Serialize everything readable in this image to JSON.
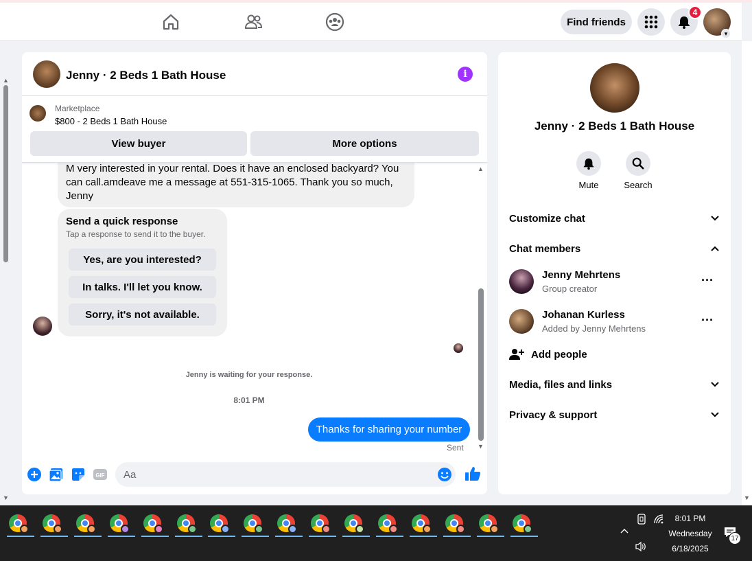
{
  "topbar": {
    "find_friends_label": "Find friends",
    "notification_count": "4",
    "icons": [
      "home-icon",
      "friends-icon",
      "groups-icon",
      "menu-grid-icon",
      "bell-icon"
    ]
  },
  "chat": {
    "header_title": "Jenny · 2 Beds 1 Bath House",
    "marketplace_label": "Marketplace",
    "marketplace_listing": "$800 - 2 Beds 1 Bath House",
    "view_buyer_label": "View buyer",
    "more_options_label": "More options",
    "incoming_message": "M very interested in your rental.  Does it have an enclosed backyard?  You can call.amdeave me a message at 551-315-1065.  Thank you so much, Jenny",
    "quick_response": {
      "title": "Send a quick response",
      "subtitle": "Tap a response to send it to the buyer.",
      "options": [
        "Yes, are you interested?",
        "In talks. I'll let you know.",
        "Sorry, it's not available."
      ]
    },
    "waiting_text": "Jenny is waiting for your response.",
    "timestamp": "8:01 PM",
    "sent_message": "Thanks for sharing your number",
    "sent_status": "Sent",
    "composer_placeholder": "Aa"
  },
  "info": {
    "title": "Jenny · 2 Beds 1 Bath House",
    "mute_label": "Mute",
    "search_label": "Search",
    "customize_chat": "Customize chat",
    "chat_members": "Chat members",
    "members": [
      {
        "name": "Jenny Mehrtens",
        "subtitle": "Group creator"
      },
      {
        "name": "Johanan Kurless",
        "subtitle": "Added by Jenny Mehrtens"
      }
    ],
    "add_people": "Add people",
    "media_files_links": "Media, files and links",
    "privacy_support": "Privacy & support"
  },
  "taskbar": {
    "time": "8:01 PM",
    "day": "Wednesday",
    "date": "6/18/2025",
    "notification_count": "17",
    "profile_colors": [
      "#f2a35e",
      "#f0a068",
      "#f4a460",
      "#b58ae0",
      "#e77fc1",
      "#7cc48a",
      "#8ab4f8",
      "#7cc48a",
      "#8ab4f8",
      "#f28b82",
      "#c5e1a5",
      "#f28b82",
      "#f4a460",
      "#f28b82",
      "#f4a460",
      "#81c995"
    ]
  },
  "colors": {
    "accent": "#0a7cff",
    "info": "#a033ff",
    "badge": "#e41e3f"
  }
}
